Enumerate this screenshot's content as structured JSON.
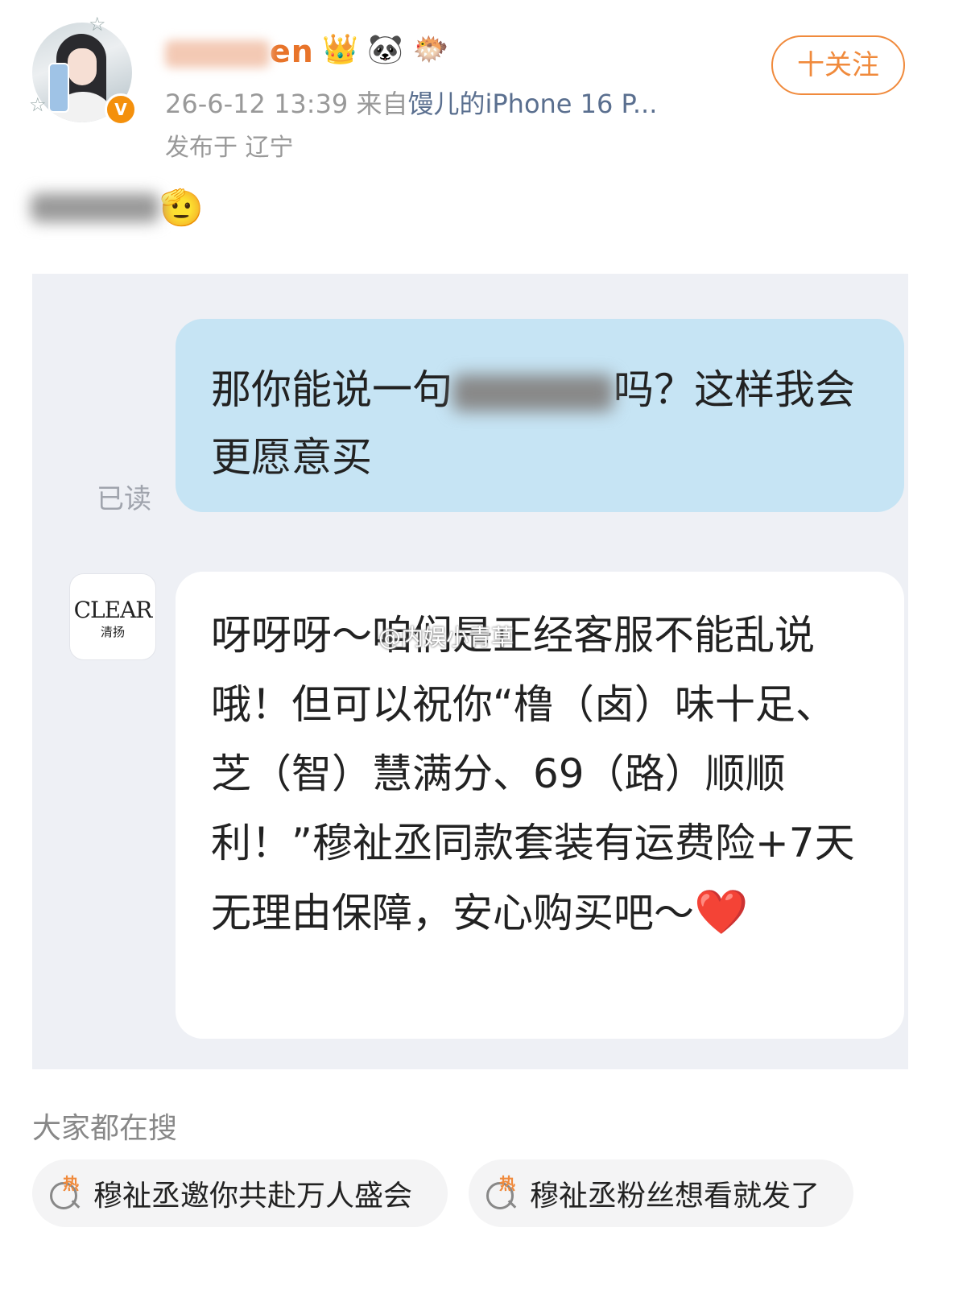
{
  "header": {
    "username_suffix": "en",
    "badges": [
      "👑",
      "🐼",
      "🐡"
    ],
    "verify_mark": "V",
    "timestamp": "26-6-12 13:39",
    "source_prefix": "来自",
    "device": "馒儿的iPhone 16 P...",
    "location": "发布于 辽宁",
    "follow_label": "十关注"
  },
  "post": {
    "suffix_emoji": "🫡"
  },
  "chat": {
    "outgoing_before": "那你能说一句",
    "outgoing_after": "吗？这样我会更愿意买",
    "read_status": "已读",
    "brand_name": "CLEAR",
    "brand_cn": "清扬",
    "incoming_message": "呀呀呀～咱们是正经客服不能乱说哦！但可以祝你“橹（卤）味十足、芝（智）慧满分、69（路）顺顺利！”穆祉丞同款套装有运费险+7天无理由保障，安心购买吧～",
    "heart": "❤️",
    "watermark": "@内娱小青草"
  },
  "trending": {
    "title": "大家都在搜",
    "hot_tag": "热",
    "chips": [
      {
        "label": "穆祉丞邀你共赴万人盛会"
      },
      {
        "label": "穆祉丞粉丝想看就发了"
      }
    ]
  }
}
